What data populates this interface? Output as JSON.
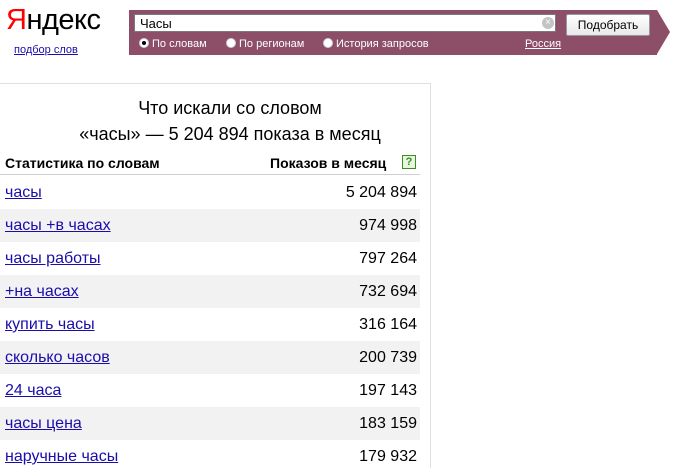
{
  "logo": {
    "first_letter": "Я",
    "rest": "ндекс",
    "subtitle": "подбор слов"
  },
  "search": {
    "value": "Часы",
    "clear_icon": "clear-icon",
    "submit_label": "Подобрать",
    "modes": [
      "По словам",
      "По регионам",
      "История запросов"
    ],
    "selected_mode": "По словам",
    "region": "Россия",
    "bar_color": "#8d4e68"
  },
  "results": {
    "heading_line1": "Что искали со словом",
    "heading_line2": "«часы» — 5 204 894 показа в месяц",
    "col_phrase": "Статистика по словам",
    "col_count": "Показов в месяц",
    "help_icon_label": "?",
    "rows": [
      {
        "term": "часы",
        "count": "5 204 894"
      },
      {
        "term": "часы +в часах",
        "count": "974 998"
      },
      {
        "term": "часы работы",
        "count": "797 264"
      },
      {
        "term": "+на часах",
        "count": "732 694"
      },
      {
        "term": "купить часы",
        "count": "316 164"
      },
      {
        "term": "сколько часов",
        "count": "200 739"
      },
      {
        "term": "24 часа",
        "count": "197 143"
      },
      {
        "term": "часы цена",
        "count": "183 159"
      },
      {
        "term": "наручные часы",
        "count": "179 932"
      }
    ]
  }
}
